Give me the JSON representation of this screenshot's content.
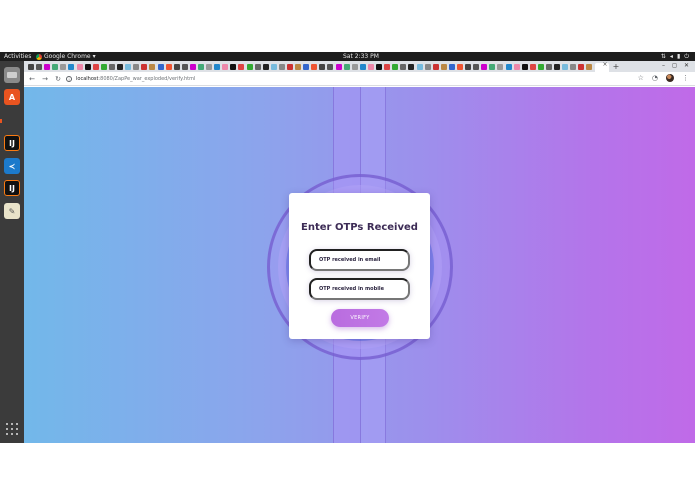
{
  "topbar": {
    "activities": "Activities",
    "app_name": "Google Chrome",
    "clock": "Sat  2:33 PM"
  },
  "browser": {
    "url_host": "localhost",
    "url_path": ":8080/ZapPe_war_exploded/verify.html",
    "new_tab_symbol": "+"
  },
  "dock": {
    "items": [
      "files-icon",
      "software-center-icon",
      "chrome-icon",
      "intellij-icon",
      "vscode-icon",
      "intellij-icon",
      "text-editor-icon",
      "app-grid-icon"
    ]
  },
  "page": {
    "title": "Enter OTPs Received",
    "email_placeholder": "OTP received in email",
    "mobile_placeholder": "OTP received in mobile",
    "verify_label": "VERIFY"
  },
  "colors": {
    "gradient_start": "#72b8ea",
    "gradient_end": "#c06ae8",
    "button": "#b96cdf",
    "title": "#3d2c56"
  }
}
